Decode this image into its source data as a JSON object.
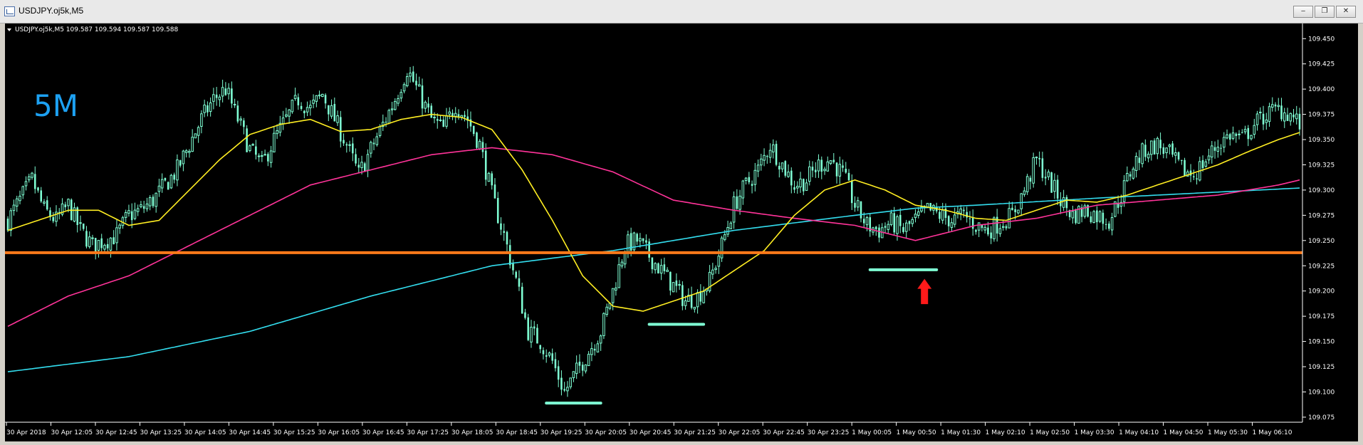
{
  "window": {
    "title": "USDJPY.oj5k,M5",
    "buttons": {
      "minimize": "‒",
      "restore": "❐",
      "close": "✕"
    }
  },
  "chart_data": {
    "type": "candlestick",
    "info_line": "USDJPY.oj5k,M5  109.587 109.594 109.587 109.588",
    "timeframe_label": "5M",
    "ylim": [
      109.07,
      109.465
    ],
    "y_ticks": [
      "109.450",
      "109.425",
      "109.400",
      "109.375",
      "109.350",
      "109.325",
      "109.300",
      "109.275",
      "109.250",
      "109.225",
      "109.200",
      "109.175",
      "109.150",
      "109.125",
      "109.100",
      "109.075"
    ],
    "x_ticks": [
      "30 Apr 2018",
      "30 Apr 12:05",
      "30 Apr 12:45",
      "30 Apr 13:25",
      "30 Apr 14:05",
      "30 Apr 14:45",
      "30 Apr 15:25",
      "30 Apr 16:05",
      "30 Apr 16:45",
      "30 Apr 17:25",
      "30 Apr 18:05",
      "30 Apr 18:45",
      "30 Apr 19:25",
      "30 Apr 20:05",
      "30 Apr 20:45",
      "30 Apr 21:25",
      "30 Apr 22:05",
      "30 Apr 22:45",
      "30 Apr 23:25",
      "1 May 00:05",
      "1 May 00:50",
      "1 May 01:30",
      "1 May 02:10",
      "1 May 02:50",
      "1 May 03:30",
      "1 May 04:10",
      "1 May 04:50",
      "1 May 05:30",
      "1 May 06:10"
    ],
    "horizontal_level": 109.238,
    "colors": {
      "background": "#000000",
      "candle": "#7fffd4",
      "ma_fast": "#ffee22",
      "ma_mid": "#ff3399",
      "ma_slow": "#33ddee",
      "level_line": "#ff7a1a",
      "marker": "#7fffd4",
      "arrow": "#ff1a1a"
    },
    "price_path": [
      [
        0,
        109.27
      ],
      [
        4,
        109.29
      ],
      [
        8,
        109.31
      ],
      [
        12,
        109.28
      ],
      [
        16,
        109.27
      ],
      [
        20,
        109.285
      ],
      [
        24,
        109.26
      ],
      [
        28,
        109.245
      ],
      [
        32,
        109.25
      ],
      [
        36,
        109.255
      ],
      [
        40,
        109.275
      ],
      [
        44,
        109.28
      ],
      [
        48,
        109.29
      ],
      [
        52,
        109.305
      ],
      [
        56,
        109.32
      ],
      [
        60,
        109.345
      ],
      [
        64,
        109.37
      ],
      [
        68,
        109.39
      ],
      [
        72,
        109.4
      ],
      [
        76,
        109.37
      ],
      [
        80,
        109.34
      ],
      [
        84,
        109.325
      ],
      [
        88,
        109.35
      ],
      [
        92,
        109.37
      ],
      [
        96,
        109.39
      ],
      [
        100,
        109.38
      ],
      [
        104,
        109.395
      ],
      [
        108,
        109.37
      ],
      [
        112,
        109.345
      ],
      [
        116,
        109.315
      ],
      [
        120,
        109.34
      ],
      [
        124,
        109.365
      ],
      [
        128,
        109.39
      ],
      [
        132,
        109.42
      ],
      [
        136,
        109.395
      ],
      [
        140,
        109.37
      ],
      [
        144,
        109.36
      ],
      [
        148,
        109.385
      ],
      [
        152,
        109.37
      ],
      [
        156,
        109.345
      ],
      [
        160,
        109.295
      ],
      [
        164,
        109.255
      ],
      [
        168,
        109.21
      ],
      [
        172,
        109.16
      ],
      [
        176,
        109.15
      ],
      [
        180,
        109.13
      ],
      [
        184,
        109.1
      ],
      [
        188,
        109.12
      ],
      [
        192,
        109.14
      ],
      [
        196,
        109.16
      ],
      [
        200,
        109.2
      ],
      [
        204,
        109.245
      ],
      [
        208,
        109.25
      ],
      [
        212,
        109.235
      ],
      [
        216,
        109.22
      ],
      [
        220,
        109.205
      ],
      [
        224,
        109.19
      ],
      [
        228,
        109.195
      ],
      [
        232,
        109.21
      ],
      [
        236,
        109.245
      ],
      [
        240,
        109.285
      ],
      [
        244,
        109.305
      ],
      [
        248,
        109.32
      ],
      [
        252,
        109.345
      ],
      [
        256,
        109.325
      ],
      [
        260,
        109.305
      ],
      [
        264,
        109.31
      ],
      [
        268,
        109.325
      ],
      [
        272,
        109.33
      ],
      [
        276,
        109.315
      ],
      [
        280,
        109.285
      ],
      [
        284,
        109.265
      ],
      [
        288,
        109.26
      ],
      [
        292,
        109.268
      ],
      [
        296,
        109.26
      ],
      [
        300,
        109.27
      ],
      [
        304,
        109.28
      ],
      [
        308,
        109.275
      ],
      [
        312,
        109.27
      ],
      [
        316,
        109.275
      ],
      [
        320,
        109.265
      ],
      [
        324,
        109.26
      ],
      [
        328,
        109.268
      ],
      [
        332,
        109.275
      ],
      [
        336,
        109.3
      ],
      [
        340,
        109.33
      ],
      [
        344,
        109.31
      ],
      [
        348,
        109.29
      ],
      [
        352,
        109.275
      ],
      [
        356,
        109.28
      ],
      [
        360,
        109.275
      ],
      [
        364,
        109.27
      ],
      [
        368,
        109.295
      ],
      [
        372,
        109.325
      ],
      [
        376,
        109.34
      ],
      [
        380,
        109.345
      ],
      [
        384,
        109.335
      ],
      [
        388,
        109.32
      ],
      [
        392,
        109.315
      ],
      [
        396,
        109.33
      ],
      [
        400,
        109.345
      ],
      [
        404,
        109.355
      ],
      [
        408,
        109.35
      ],
      [
        412,
        109.365
      ],
      [
        416,
        109.375
      ],
      [
        420,
        109.38
      ],
      [
        424,
        109.375
      ],
      [
        427,
        109.365
      ]
    ],
    "ma_fast": [
      [
        0,
        109.26
      ],
      [
        20,
        109.28
      ],
      [
        30,
        109.28
      ],
      [
        40,
        109.265
      ],
      [
        50,
        109.27
      ],
      [
        60,
        109.3
      ],
      [
        70,
        109.33
      ],
      [
        80,
        109.355
      ],
      [
        90,
        109.365
      ],
      [
        100,
        109.37
      ],
      [
        110,
        109.358
      ],
      [
        120,
        109.36
      ],
      [
        130,
        109.37
      ],
      [
        140,
        109.375
      ],
      [
        150,
        109.372
      ],
      [
        160,
        109.36
      ],
      [
        170,
        109.32
      ],
      [
        180,
        109.27
      ],
      [
        190,
        109.215
      ],
      [
        200,
        109.185
      ],
      [
        210,
        109.18
      ],
      [
        220,
        109.19
      ],
      [
        230,
        109.2
      ],
      [
        240,
        109.22
      ],
      [
        250,
        109.24
      ],
      [
        260,
        109.275
      ],
      [
        270,
        109.3
      ],
      [
        280,
        109.31
      ],
      [
        290,
        109.3
      ],
      [
        300,
        109.285
      ],
      [
        310,
        109.28
      ],
      [
        320,
        109.272
      ],
      [
        330,
        109.27
      ],
      [
        340,
        109.28
      ],
      [
        350,
        109.29
      ],
      [
        360,
        109.288
      ],
      [
        370,
        109.295
      ],
      [
        380,
        109.305
      ],
      [
        390,
        109.315
      ],
      [
        400,
        109.325
      ],
      [
        410,
        109.338
      ],
      [
        420,
        109.35
      ],
      [
        427,
        109.357
      ]
    ],
    "ma_mid": [
      [
        0,
        109.165
      ],
      [
        20,
        109.195
      ],
      [
        40,
        109.215
      ],
      [
        60,
        109.245
      ],
      [
        80,
        109.275
      ],
      [
        100,
        109.305
      ],
      [
        120,
        109.32
      ],
      [
        140,
        109.335
      ],
      [
        160,
        109.342
      ],
      [
        180,
        109.335
      ],
      [
        200,
        109.318
      ],
      [
        220,
        109.29
      ],
      [
        240,
        109.28
      ],
      [
        260,
        109.272
      ],
      [
        280,
        109.265
      ],
      [
        300,
        109.25
      ],
      [
        320,
        109.265
      ],
      [
        340,
        109.272
      ],
      [
        360,
        109.285
      ],
      [
        380,
        109.29
      ],
      [
        400,
        109.295
      ],
      [
        420,
        109.305
      ],
      [
        427,
        109.31
      ]
    ],
    "ma_slow": [
      [
        0,
        109.12
      ],
      [
        40,
        109.135
      ],
      [
        80,
        109.16
      ],
      [
        120,
        109.195
      ],
      [
        160,
        109.225
      ],
      [
        200,
        109.24
      ],
      [
        240,
        109.26
      ],
      [
        280,
        109.275
      ],
      [
        300,
        109.282
      ],
      [
        320,
        109.285
      ],
      [
        360,
        109.292
      ],
      [
        400,
        109.298
      ],
      [
        427,
        109.302
      ]
    ],
    "markers": [
      {
        "name": "low-marker-1",
        "x1": 178,
        "x2": 196,
        "y": 109.089
      },
      {
        "name": "low-marker-2",
        "x1": 212,
        "x2": 230,
        "y": 109.167
      },
      {
        "name": "low-marker-3",
        "x1": 285,
        "x2": 307,
        "y": 109.221
      }
    ],
    "arrow": {
      "x": 303,
      "y_tip": 109.212,
      "y_base": 109.187
    }
  }
}
